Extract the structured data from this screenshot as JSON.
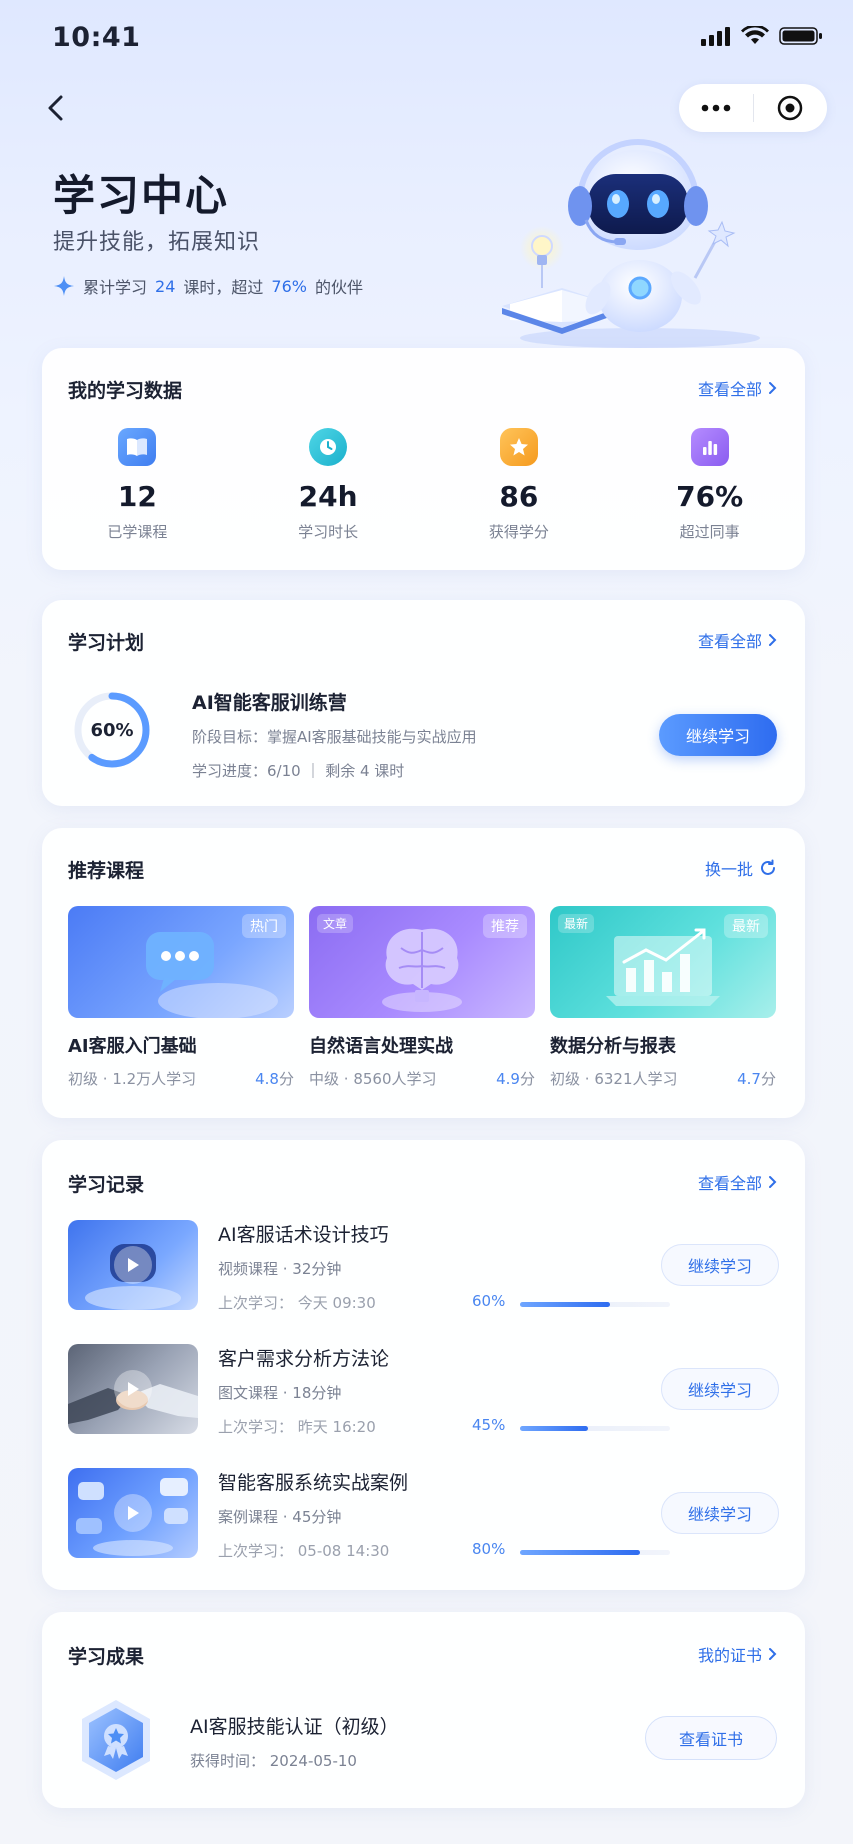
{
  "status_bar": {
    "time": "10:41"
  },
  "hero": {
    "title": "学习中心",
    "subtitle": "提升技能，拓展知识",
    "stat_prefix": "累计学习",
    "stat_lessons": "24",
    "stat_mid": "课时，超过",
    "stat_percent": "76%",
    "stat_suffix": "的伙伴"
  },
  "learning_data": {
    "title": "我的学习数据",
    "link": "查看全部",
    "stats": [
      {
        "value": "12",
        "label": "已学课程",
        "icon": "book-icon",
        "color": "#4d8ff5"
      },
      {
        "value": "24h",
        "label": "学习时长",
        "icon": "clock-icon",
        "color": "#27c0d6"
      },
      {
        "value": "86",
        "label": "获得学分",
        "icon": "star-badge-icon",
        "color": "#f5a623"
      },
      {
        "value": "76%",
        "label": "超过同事",
        "icon": "bar-chart-icon",
        "color": "#9b6cf0"
      }
    ]
  },
  "plan": {
    "title": "学习计划",
    "link": "查看全部",
    "progress": 0.6,
    "progress_text": "60%",
    "name": "AI智能客服训练营",
    "goal": "阶段目标：掌握AI客服基础技能与实战应用",
    "progress_detail": "学习进度：6/10  ｜  剩余 4 课时",
    "button": "继续学习"
  },
  "recommended": {
    "title": "推荐课程",
    "link": "换一批",
    "courses": [
      {
        "name": "AI客服入门基础",
        "tag": "热门",
        "corner": "",
        "level": "初级",
        "learners": "1.2万人学习",
        "rating_value": "4.8",
        "rating_unit": "分"
      },
      {
        "name": "自然语言处理实战",
        "tag": "推荐",
        "corner": "文章",
        "level": "中级",
        "learners": "8560人学习",
        "rating_value": "4.9",
        "rating_unit": "分"
      },
      {
        "name": "数据分析与报表",
        "tag": "最新",
        "corner": "最新",
        "level": "初级",
        "learners": "6321人学习",
        "rating_value": "4.7",
        "rating_unit": "分"
      }
    ]
  },
  "history": {
    "title": "学习记录",
    "link": "查看全部",
    "items": [
      {
        "title": "AI客服话术设计技巧",
        "meta": "视频课程 · 32分钟",
        "last": "上次学习：  今天 09:30",
        "percent_text": "60%",
        "progress": 0.6,
        "button": "继续学习"
      },
      {
        "title": "客户需求分析方法论",
        "meta": "图文课程 · 18分钟",
        "last": "上次学习：  昨天 16:20",
        "percent_text": "45%",
        "progress": 0.45,
        "button": "继续学习"
      },
      {
        "title": "智能客服系统实战案例",
        "meta": "案例课程 · 45分钟",
        "last": "上次学习：  05-08 14:30",
        "percent_text": "80%",
        "progress": 0.8,
        "button": "继续学习"
      }
    ]
  },
  "achievements": {
    "title": "学习成果",
    "link": "我的证书",
    "cert_name": "AI客服技能认证（初级）",
    "cert_time": "获得时间：  2024-05-10",
    "button": "查看证书"
  }
}
